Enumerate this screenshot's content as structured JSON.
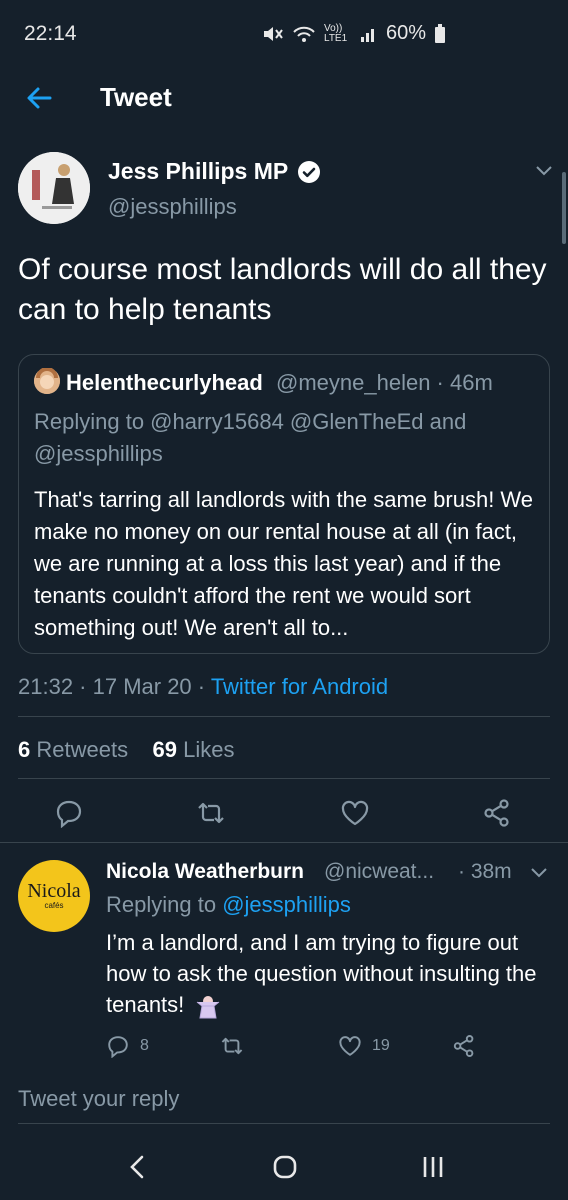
{
  "status_bar": {
    "time": "22:14",
    "network": "Vo)) LTE1",
    "battery": "60%",
    "icons": [
      "mute-icon",
      "wifi-icon",
      "signal-icon",
      "battery-icon"
    ]
  },
  "header": {
    "title": "Tweet",
    "back_icon": "back-arrow-icon"
  },
  "tweet": {
    "author_name": "Jess Phillips MP",
    "author_handle": "@jessphillips",
    "verified": true,
    "text": "Of course most landlords will do all they can to help tenants",
    "quoted": {
      "name": "Helenthecurlyhead",
      "meta": "@meyne_helen · 46m",
      "replying_to": "Replying to @harry15684 @GlenTheEd and @jessphillips",
      "text": "That's tarring all landlords with the same brush! We make no money on our rental house at all (in fact, we are running at a loss this last year) and if the tenants couldn't afford the rent we would sort something out! We aren't all to..."
    },
    "timestamp": "21:32 · 17 Mar 20 · ",
    "source": "Twitter for Android",
    "retweets_count": "6",
    "retweets_label": "Retweets",
    "likes_count": "69",
    "likes_label": "Likes"
  },
  "reply": {
    "avatar_logo": "Nicola",
    "avatar_sub": "cafés",
    "author_name": "Nicola Weatherburn",
    "author_handle": "@nicweat...",
    "time": "· 38m",
    "replying_prefix": "Replying to ",
    "replying_mention": "@jessphillips",
    "text": "I’m a landlord, and I am trying to figure out how to ask the question without insulting the tenants!",
    "reply_count": "8",
    "like_count": "19"
  },
  "composer": {
    "placeholder": "Tweet your reply"
  },
  "colors": {
    "background": "#15202b",
    "accent": "#1da1f2",
    "muted": "#8899a6",
    "border": "#38444d"
  }
}
